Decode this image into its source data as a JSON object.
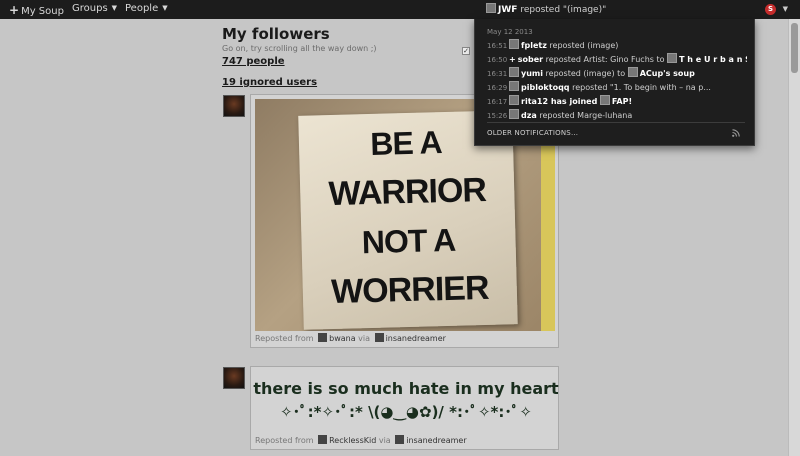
{
  "topbar": {
    "my_soup": "My Soup",
    "groups": "Groups",
    "people": "People",
    "notif_user": "JWF",
    "notif_text": "reposted \"(image)\""
  },
  "main": {
    "title": "My followers",
    "subtitle": "Go on, try scrolling all the way down ;)",
    "people_count": "747 people",
    "ignored": "19 ignored users"
  },
  "posts": [
    {
      "poster_lines": [
        "BE A",
        "WARRIOR",
        "NOT A",
        "WORRIER"
      ],
      "reposted_label": "Reposted from",
      "from_user": "bwana",
      "via_label": "via",
      "via_user": "insanedreamer"
    },
    {
      "quote_line1": "there is so much hate in my heart",
      "quote_line2": "✧･ﾟ:*✧･ﾟ:* \\(◕‿◕✿)/ *:･ﾟ✧*:･ﾟ✧",
      "reposted_label": "Reposted from",
      "from_user": "RecklessKid",
      "via_label": "via",
      "via_user": "insanedreamer"
    }
  ],
  "notifications": {
    "date": "May 12 2013",
    "items": [
      {
        "time": "16:51",
        "user": "fpletz",
        "text": "reposted (image)",
        "target": ""
      },
      {
        "time": "16:50",
        "user": "sober",
        "text": "reposted Artist: Gino Fuchs to",
        "target": "T h e U r b a n S o u p"
      },
      {
        "time": "16:31",
        "user": "yumi",
        "text": "reposted (image) to",
        "target": "ACup's soup"
      },
      {
        "time": "16:29",
        "user": "pibloktoqq",
        "text": "reposted \"1.    To begin with – na p...",
        "target": ""
      },
      {
        "time": "16:17",
        "user": "rita12 has joined",
        "text": "",
        "target": "FAP!"
      },
      {
        "time": "15:26",
        "user": "dza",
        "text": "reposted Marge-luhana",
        "target": ""
      }
    ],
    "older": "OLDER NOTIFICATIONS..."
  },
  "colors": {
    "topbar_bg": "#1c1c1c",
    "page_bg": "#c6c6c6",
    "badge": "#c52c2c"
  }
}
